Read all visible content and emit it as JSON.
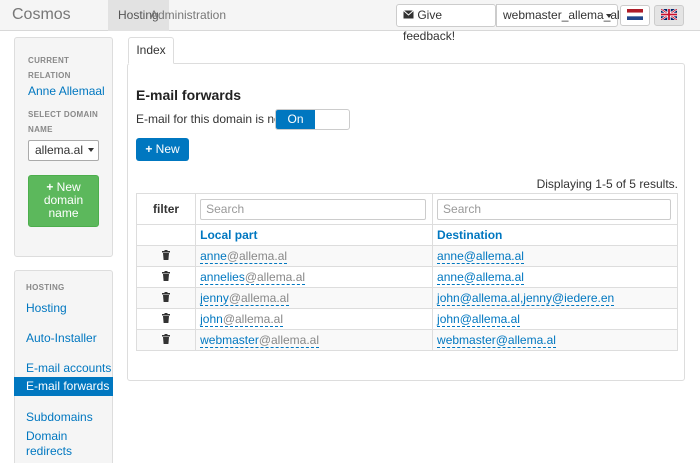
{
  "app": {
    "brand": "Cosmos"
  },
  "nav": {
    "tabs": [
      {
        "label": "Hosting",
        "active": true
      },
      {
        "label": "Administration",
        "active": false
      }
    ],
    "feedback_label": "Give feedback!",
    "user_label": "webmaster_allema_al",
    "languages": [
      {
        "icon": "flag-nl-icon",
        "active": false
      },
      {
        "icon": "flag-uk-icon",
        "active": true
      }
    ]
  },
  "sidebar": {
    "current_relation_caption": "CURRENT RELATION",
    "current_relation": "Anne Allemaal",
    "select_domain_caption": "SELECT DOMAIN NAME",
    "selected_domain": "allema.al",
    "new_domain_label": "New domain name",
    "hosting_caption": "HOSTING",
    "items": [
      {
        "label": "Hosting"
      },
      {
        "label": "Auto-Installer"
      },
      {
        "label": "E-mail accounts"
      },
      {
        "label": "E-mail forwards",
        "active": true
      },
      {
        "label": "Subdomains"
      },
      {
        "label": "Domain redirects"
      }
    ]
  },
  "main": {
    "tab_label": "Index",
    "title": "E-mail forwards",
    "status_label": "E-mail for this domain is now:",
    "toggle_on_label": "On",
    "new_button_label": "New",
    "results_text": "Displaying 1-5 of 5 results.",
    "filter_label": "filter",
    "search_placeholder": "Search",
    "columns": [
      "Local part",
      "Destination"
    ],
    "rows": [
      {
        "local": "anne",
        "domain": "@allema.al",
        "destination": "anne@allema.al"
      },
      {
        "local": "annelies",
        "domain": "@allema.al",
        "destination": "anne@allema.al"
      },
      {
        "local": "jenny",
        "domain": "@allema.al",
        "destination": "john@allema.al,jenny@iedere.en"
      },
      {
        "local": "john",
        "domain": "@allema.al",
        "destination": "john@allema.al"
      },
      {
        "local": "webmaster",
        "domain": "@allema.al",
        "destination": "webmaster@allema.al"
      }
    ]
  },
  "colors": {
    "accent": "#0077c0",
    "success": "#5cb85c"
  }
}
